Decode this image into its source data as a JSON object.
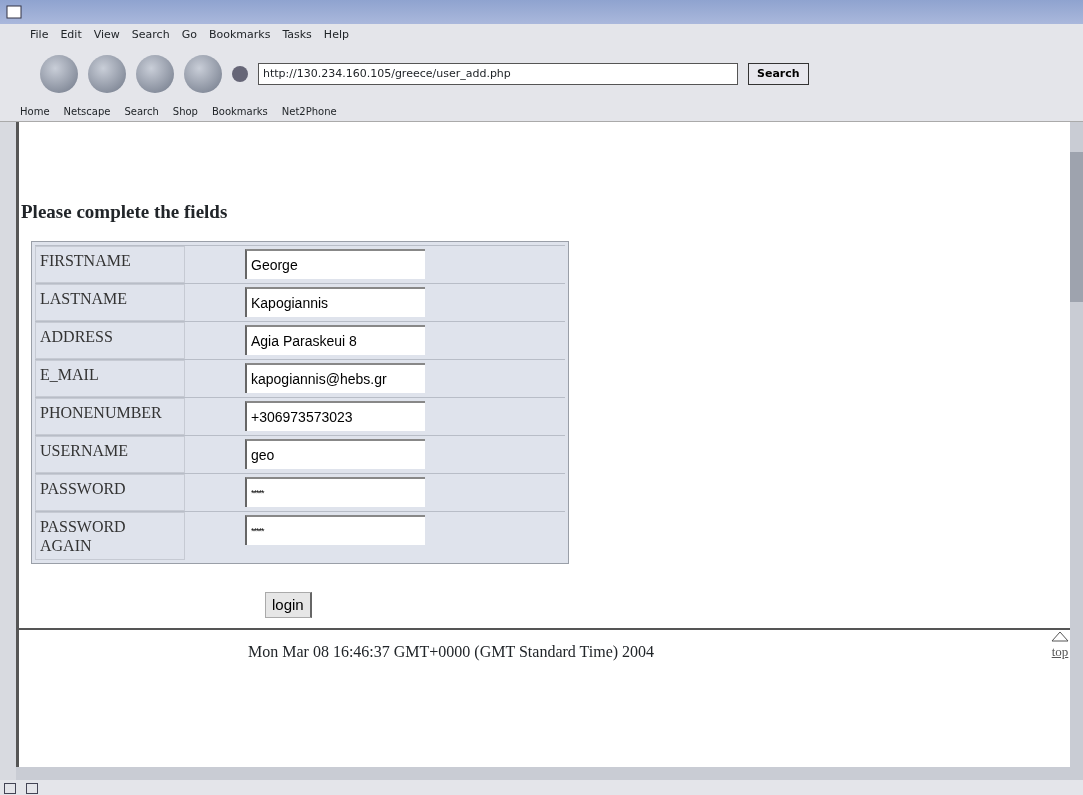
{
  "menu": [
    "File",
    "Edit",
    "View",
    "Search",
    "Go",
    "Bookmarks",
    "Tasks",
    "Help"
  ],
  "address": {
    "value": "http://130.234.160.105/greece/user_add.php"
  },
  "search_button": "Search",
  "personal_toolbar": [
    "Home",
    "Netscape",
    "Search",
    "Shop",
    "Bookmarks",
    "Net2Phone"
  ],
  "page": {
    "heading": "Please complete the fields",
    "fields": [
      {
        "label": "FIRSTNAME",
        "value": "George",
        "kind": "text"
      },
      {
        "label": "LASTNAME",
        "value": "Kapogiannis",
        "kind": "text"
      },
      {
        "label": "ADDRESS",
        "value": "Agia Paraskeui 8",
        "kind": "text"
      },
      {
        "label": "E_MAIL",
        "value": "kapogiannis@hebs.gr",
        "kind": "text"
      },
      {
        "label": "PHONENUMBER",
        "value": "+306973573023",
        "kind": "text"
      },
      {
        "label": "USERNAME",
        "value": "geo",
        "kind": "text"
      },
      {
        "label": "PASSWORD",
        "value": "*****",
        "kind": "password"
      },
      {
        "label": "PASSWORD AGAIN",
        "value": "*****",
        "kind": "password"
      }
    ],
    "submit": "login",
    "footer_date": "Mon Mar 08 16:46:37 GMT+0000 (GMT Standard Time) 2004",
    "top_link": "top"
  }
}
